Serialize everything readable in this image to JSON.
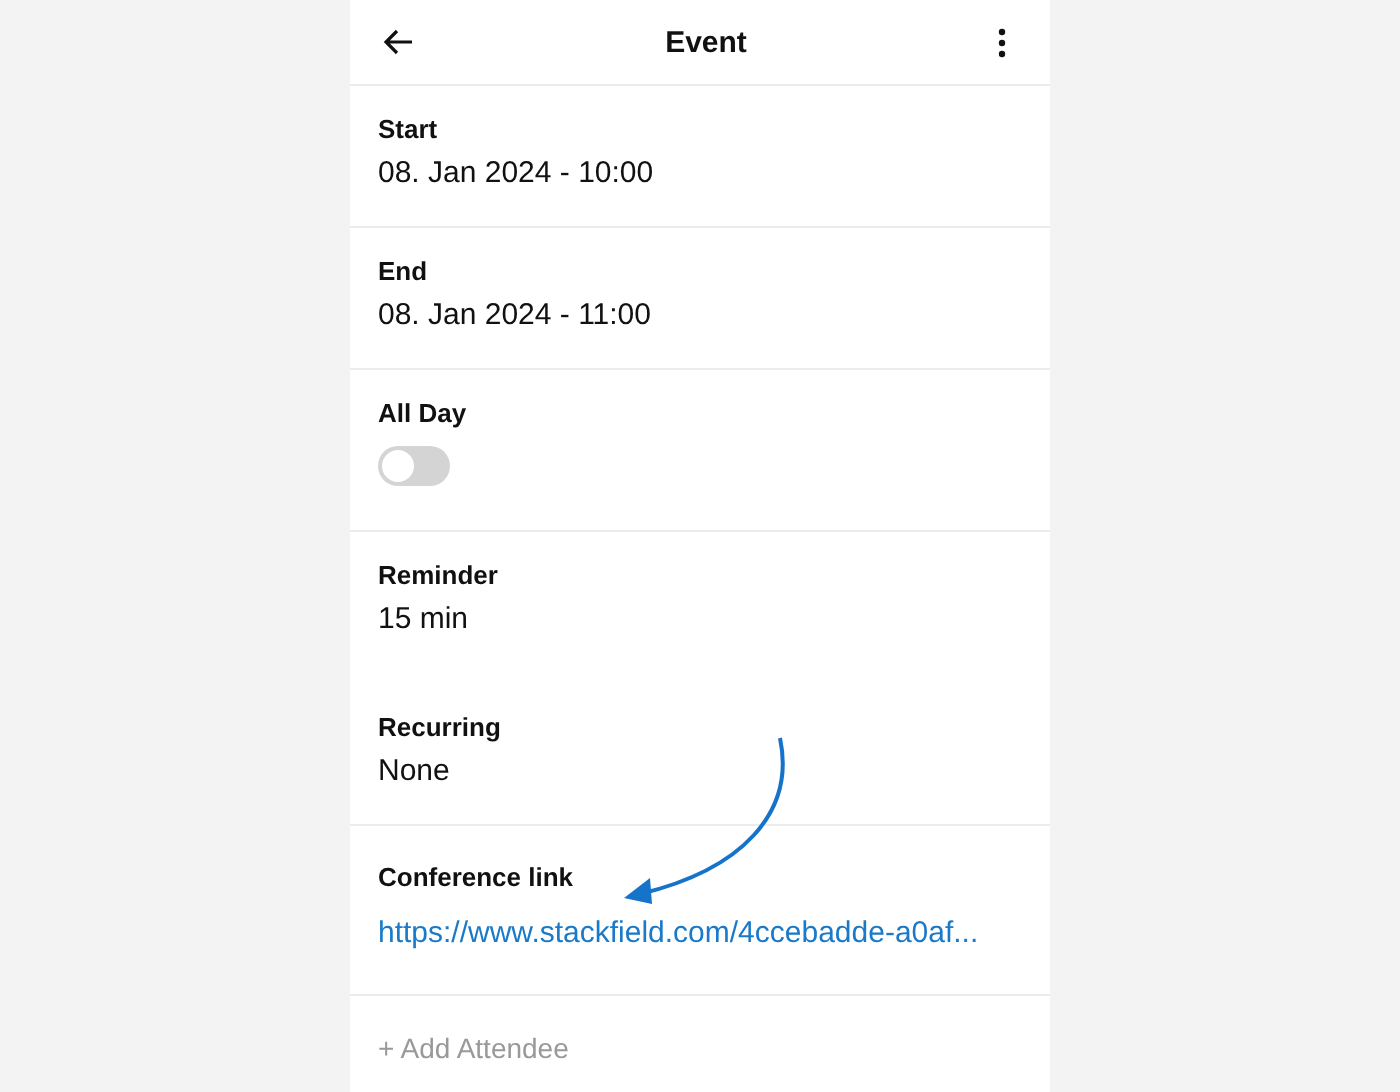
{
  "header": {
    "title": "Event"
  },
  "sections": [
    {
      "fields": [
        {
          "kind": "text",
          "label": "Start",
          "value": "08. Jan 2024 - 10:00"
        }
      ]
    },
    {
      "fields": [
        {
          "kind": "text",
          "label": "End",
          "value": "08. Jan 2024 - 11:00"
        }
      ]
    },
    {
      "fields": [
        {
          "kind": "toggle",
          "label": "All Day",
          "on": false
        }
      ]
    },
    {
      "fields": [
        {
          "kind": "text",
          "label": "Reminder",
          "value": "15 min"
        },
        {
          "kind": "text",
          "label": "Recurring",
          "value": "None"
        }
      ]
    },
    {
      "fields": [
        {
          "kind": "link",
          "label": "Conference link",
          "value": "https://www.stackfield.com/4ccebadde-a0af..."
        }
      ]
    }
  ],
  "add_attendee": {
    "label": "+ Add Attendee"
  }
}
